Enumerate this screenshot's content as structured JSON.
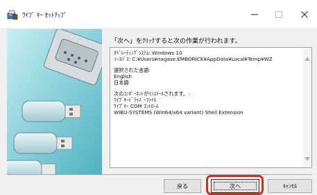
{
  "window": {
    "title": "ﾜｲﾌﾟ ｷｰ ｾｯﾄｱｯﾌﾟ",
    "app_icon": "setup-installer-icon",
    "controls": [
      "minimize-icon",
      "maximize-icon",
      "close-icon"
    ]
  },
  "banner": {
    "image": "usb-keys-banner"
  },
  "main": {
    "instruction": "「次へ」をｸﾘｯｸすると次の作業が行われます。",
    "log_lines": [
      "ｵﾍﾟﾚｰﾃｨﾝｸﾞｼｽﾃﾑ: Windows 10",
      "ｿｰｽﾊﾟｽ: C:¥Users¥nagase.EMBORICK¥AppData¥Local¥Temp¥WZ",
      "",
      "選択された言語:",
      "English",
      "日本語",
      "",
      "次のｺﾝﾎﾟｰﾈﾝﾄがｲﾝｽﾄｰﾙされます。:",
      "ﾜｲﾌﾟｷｰﾄﾞﾗｲﾊﾞｰﾌｧｲﾙ",
      "ﾜｲﾌﾟｷｰ COM ｺﾝﾄﾛｰﾙ",
      "WIBU-SYSTEMS (Win64/x64 variant) Shell Extension"
    ]
  },
  "buttons": {
    "back": "戻る",
    "next": "次へ",
    "cancel": "ｷｬﾝｾﾙ"
  },
  "colors": {
    "highlight": "#e8201c",
    "window_bg": "#f0f0f0",
    "button_bg": "#e3e3e3"
  }
}
